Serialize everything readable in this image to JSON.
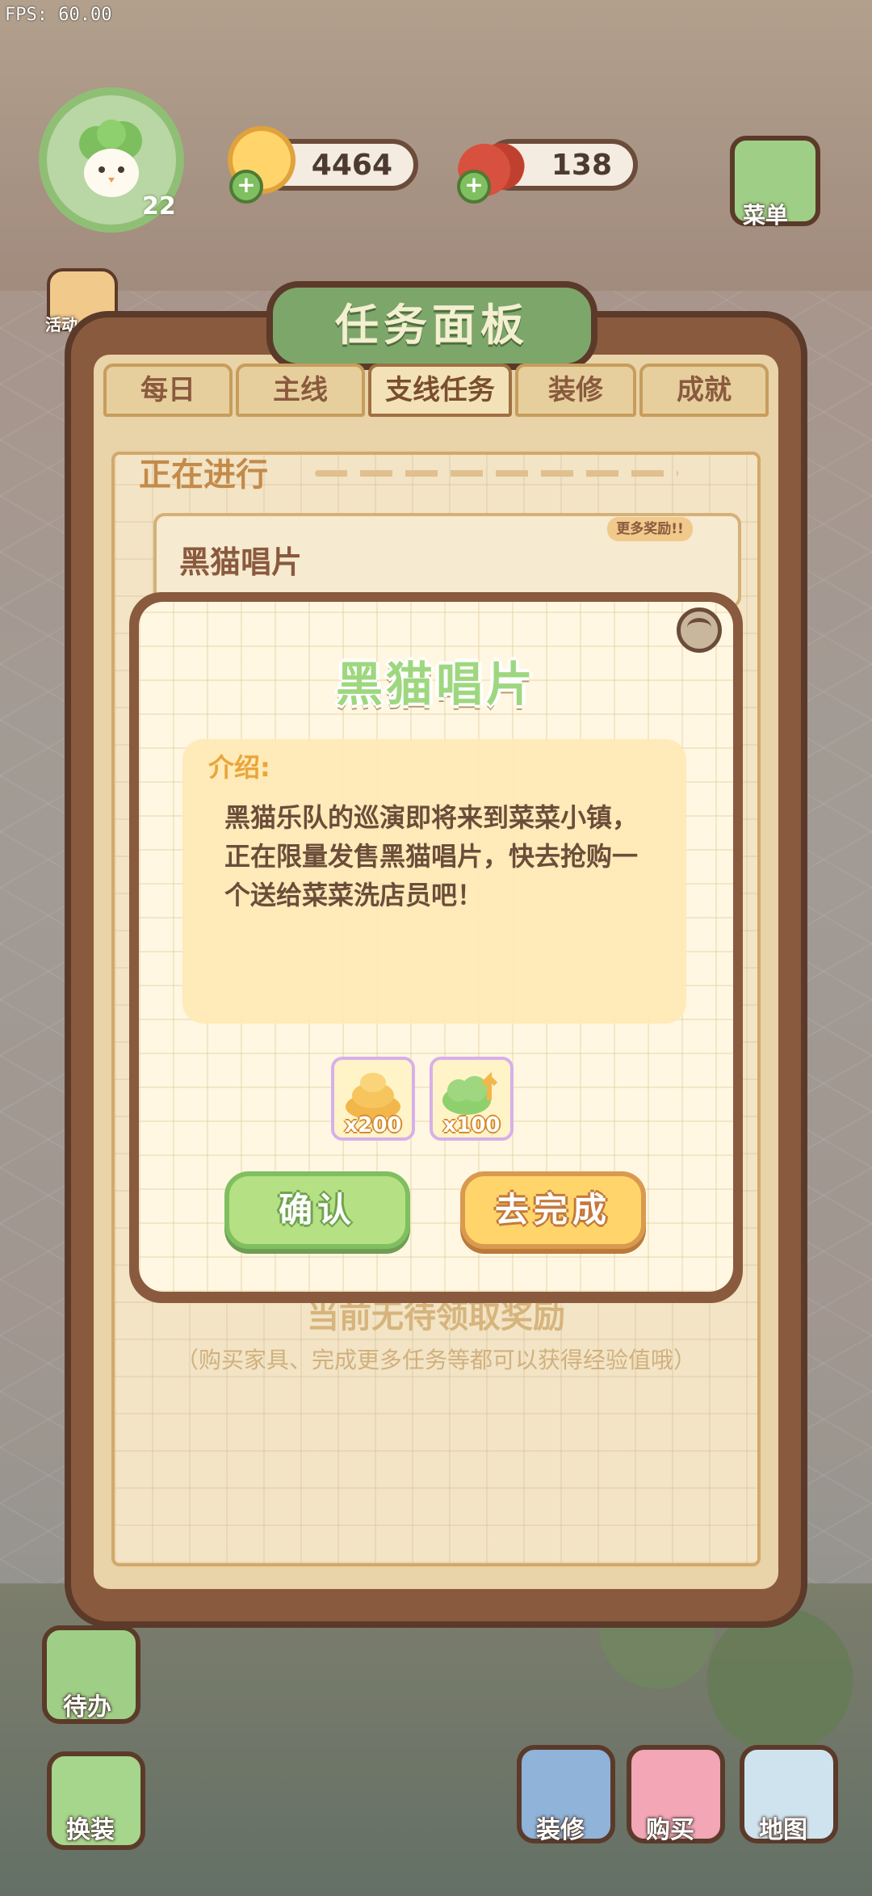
{
  "fps": "FPS: 60.00",
  "player": {
    "level": "22"
  },
  "currency": {
    "coins": "4464",
    "hearts": "138"
  },
  "side_buttons": {
    "menu": "菜单",
    "event": "活动"
  },
  "panel": {
    "title": "任务面板",
    "tabs": [
      "每日",
      "主线",
      "支线任务",
      "装修",
      "成就"
    ],
    "active_tab": "支线任务",
    "section": "正在进行",
    "task_title": "黑猫唱片",
    "more_reward": "更多奖励!!",
    "empty_title": "当前无待领取奖励",
    "empty_sub": "（购买家具、完成更多任务等都可以获得经验值哦）"
  },
  "dialog": {
    "title": "黑猫唱片",
    "intro_label": "介绍:",
    "intro_text": "黑猫乐队的巡演即将来到菜菜小镇，正在限量发售黑猫唱片，快去抢购一个送给菜菜洗店员吧！",
    "rewards": [
      {
        "icon": "gold-coin-pile-icon",
        "qty": "x200"
      },
      {
        "icon": "green-exp-icon",
        "qty": "x100"
      }
    ],
    "confirm": "确认",
    "go_complete": "去完成"
  },
  "bottom_bar": {
    "todo": "待办",
    "dress": "换装",
    "decorate": "装修",
    "buy": "购买",
    "map": "地图"
  },
  "colors": {
    "panel_brown": "#8a5a3e",
    "title_green": "#7da66a",
    "confirm_green": "#b6e084",
    "go_yellow": "#ffd56b"
  }
}
